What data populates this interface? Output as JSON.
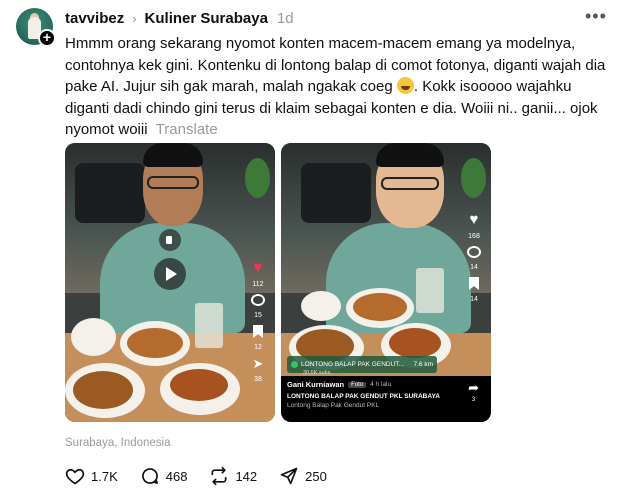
{
  "post": {
    "username": "tavvibez",
    "community": "Kuliner Surabaya",
    "time": "1d",
    "text_before_emoji": "Hmmm orang sekarang nyomot konten macem-macem emang ya modelnya, contohnya kek gini. Kontenku di lontong balap di comot fotonya, diganti wajah dia pake AI. Jujur sih gak marah, malah ngakak coeg",
    "text_after_emoji": ". Kokk isooooo wajahku diganti dadi chindo gini terus di klaim sebagai konten e dia. Woiii ni.. ganii... ojok nyomot woiii",
    "translate_label": "Translate",
    "location": "Surabaya, Indonesia"
  },
  "media2": {
    "counts": {
      "likes": "168",
      "comments": "14",
      "saves": "14"
    },
    "place_name": "LONTONG BALAP PAK GENDUT...",
    "place_distance": "7.6 km",
    "place_sub": "30,6K suka",
    "author": "Gani Kurniawan",
    "badge": "Foto",
    "time": "4 h lalu",
    "title": "LONTONG BALAP PAK GENDUT PKL SURABAYA",
    "subtitle": "Lontong Balap Pak Gendut PKL",
    "share_count": "3"
  },
  "media1": {
    "counts": {
      "likes": "112",
      "comments": "15",
      "saves": "12",
      "shares": "38"
    }
  },
  "actions": {
    "likes": "1.7K",
    "replies": "468",
    "reposts": "142",
    "shares": "250"
  },
  "icons": [
    "heart-icon",
    "comment-icon",
    "repost-icon",
    "share-icon",
    "more-icon",
    "chevron-right-icon",
    "play-icon",
    "sound-icon"
  ]
}
